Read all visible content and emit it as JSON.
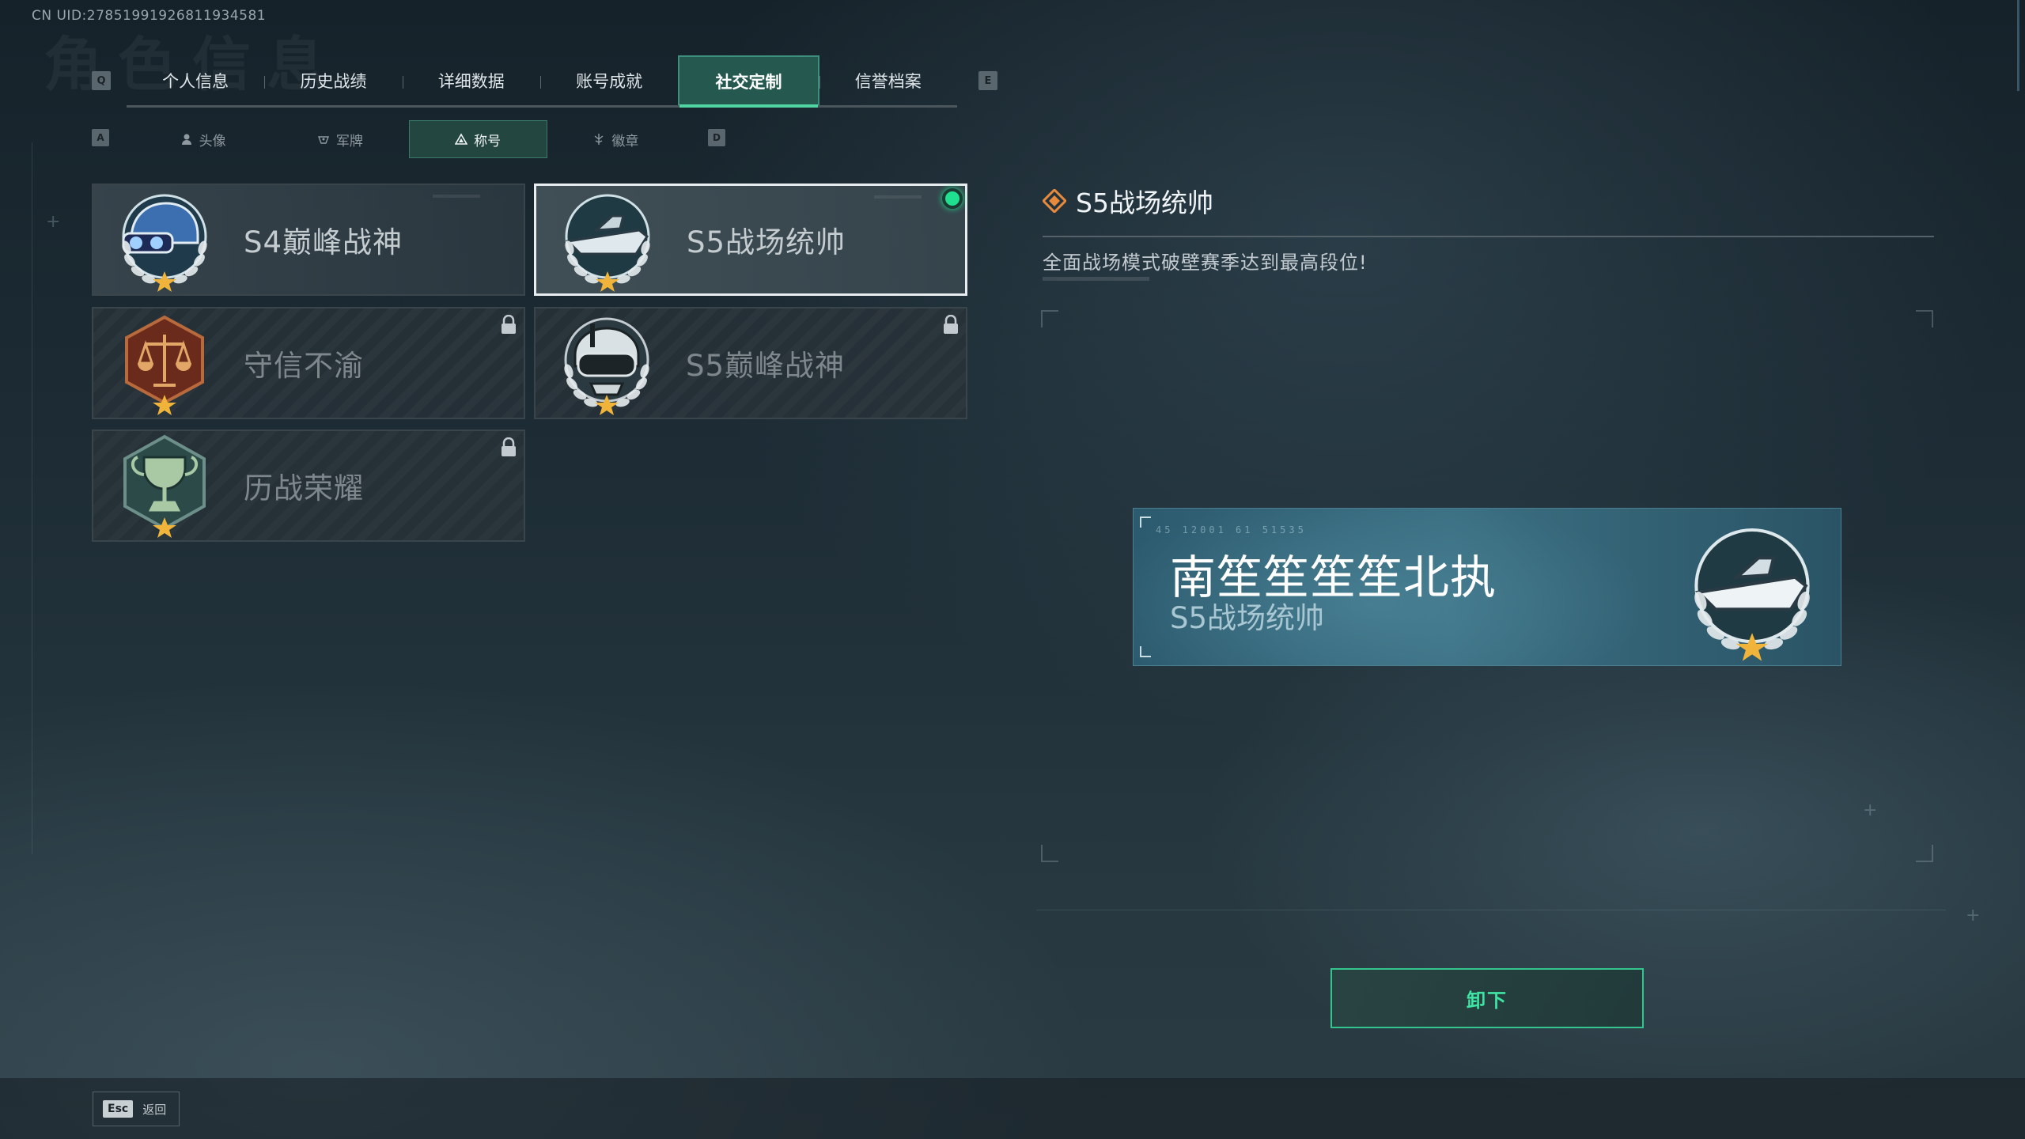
{
  "header": {
    "uid": "CN UID:2785199192681193458​1",
    "ghost_title": "角色信息"
  },
  "tabs": {
    "prev_key": "Q",
    "next_key": "E",
    "items": [
      {
        "label": "个人信息"
      },
      {
        "label": "历史战绩"
      },
      {
        "label": "详细数据"
      },
      {
        "label": "账号成就"
      },
      {
        "label": "社交定制",
        "active": true
      },
      {
        "label": "信誉档案"
      }
    ]
  },
  "subtabs": {
    "prev_key": "A",
    "next_key": "D",
    "items": [
      {
        "label": "头像",
        "icon": "person-icon"
      },
      {
        "label": "军牌",
        "icon": "dogtag-icon"
      },
      {
        "label": "称号",
        "icon": "title-icon",
        "active": true
      },
      {
        "label": "徽章",
        "icon": "badge-icon"
      }
    ]
  },
  "titles": [
    {
      "name": "S4巅峰战神",
      "emblem": "helmet-emblem-icon",
      "locked": false,
      "selected": false
    },
    {
      "name": "S5战场统帅",
      "emblem": "boat-emblem-icon",
      "locked": false,
      "selected": true,
      "equipped": true
    },
    {
      "name": "守信不渝",
      "emblem": "scales-emblem-icon",
      "locked": true
    },
    {
      "name": "S5巅峰战神",
      "emblem": "diver-emblem-icon",
      "locked": true
    },
    {
      "name": "历战荣耀",
      "emblem": "trophy-emblem-icon",
      "locked": true
    }
  ],
  "detail": {
    "title": "S5战场统帅",
    "description": "全面战场模式破壁赛季达到最高段位!"
  },
  "preview": {
    "player_name": "南笙笙笙笙北执",
    "title": "S5战场统帅",
    "code": "45 12001 61 51535"
  },
  "actions": {
    "unequip_label": "卸下"
  },
  "footer": {
    "esc_key": "Esc",
    "esc_label": "返回"
  },
  "colors": {
    "accent": "#4fd6a3",
    "equipped_dot": "#1fe08f",
    "active_tab": "#25594f",
    "preview_bg": "#3b6f82"
  }
}
